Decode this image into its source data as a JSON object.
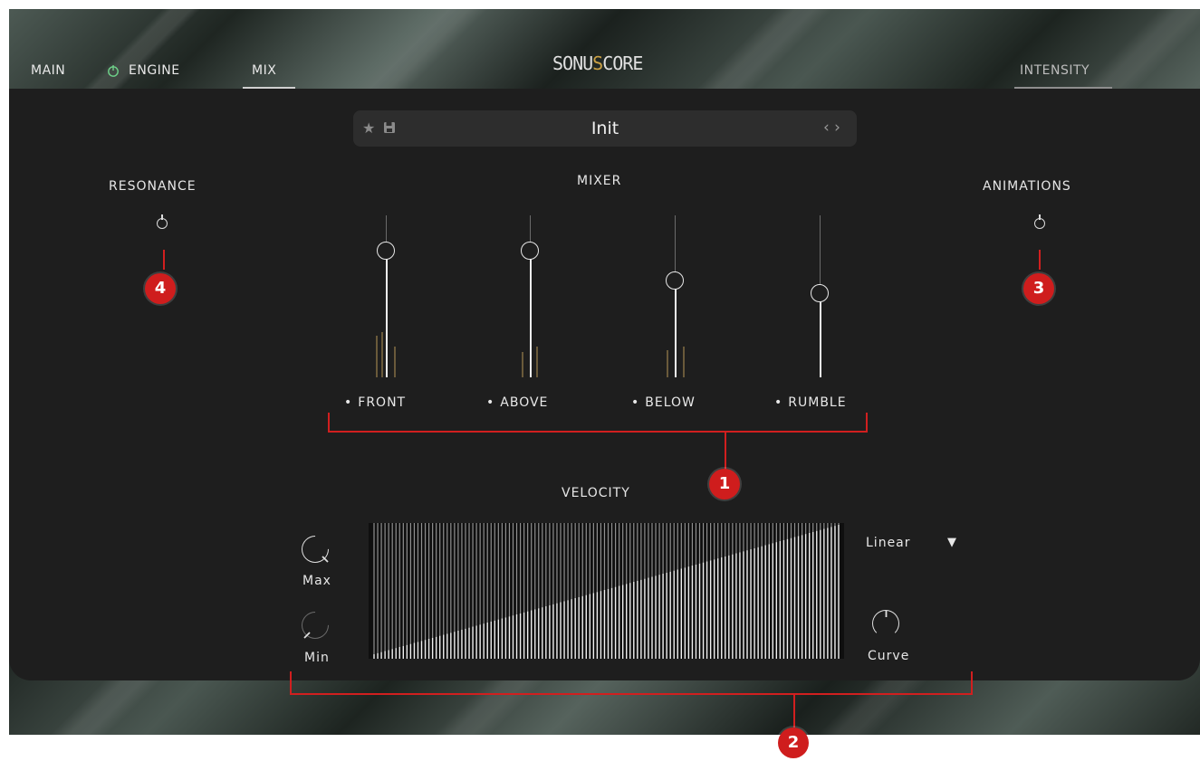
{
  "tabs": {
    "main": "MAIN",
    "engine": "ENGINE",
    "mix": "MIX",
    "intensity": "INTENSITY",
    "power_icon": "power-icon"
  },
  "logo": {
    "text_pre": "SONU",
    "text_s": "S",
    "text_post": "CORE"
  },
  "preset": {
    "name": "Init",
    "star_icon": "★",
    "save_icon": "▪",
    "nav_icon": "‹ ›"
  },
  "resonance": {
    "label": "RESONANCE"
  },
  "animations": {
    "label": "ANIMATIONS"
  },
  "mixer": {
    "title": "MIXER",
    "channels": [
      {
        "label": "FRONT",
        "level": 0.78
      },
      {
        "label": "ABOVE",
        "level": 0.78
      },
      {
        "label": "BELOW",
        "level": 0.6
      },
      {
        "label": "RUMBLE",
        "level": 0.52
      }
    ]
  },
  "velocity": {
    "title": "VELOCITY",
    "max_label": "Max",
    "min_label": "Min",
    "curve_label": "Curve",
    "curve_type": "Linear",
    "dropdown_arrow": "▼"
  },
  "callouts": {
    "c1": "1",
    "c2": "2",
    "c3": "3",
    "c4": "4"
  },
  "colors": {
    "accent_red": "#cf1d1d",
    "panel": "#1e1e1e",
    "engine_power": "#6fd38a",
    "logo_s": "#c9a045"
  }
}
